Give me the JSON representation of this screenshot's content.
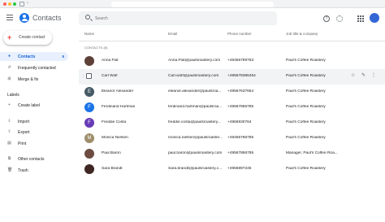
{
  "browser": {
    "url": ""
  },
  "app": {
    "title": "Contacts"
  },
  "search": {
    "placeholder": "Search"
  },
  "account": {
    "avatar_text": ""
  },
  "sidebar": {
    "create_label": "Create contact",
    "items": [
      {
        "label": "Contacts",
        "count": "8",
        "icon": "person-icon",
        "active": true
      },
      {
        "label": "Frequently contacted",
        "icon": "history-icon"
      },
      {
        "label": "Merge & fix",
        "icon": "merge-icon"
      }
    ],
    "labels_heading": "Labels",
    "create_label_item": "Create label",
    "tools": [
      {
        "label": "Import",
        "icon": "import-icon"
      },
      {
        "label": "Export",
        "icon": "export-icon"
      },
      {
        "label": "Print",
        "icon": "print-icon"
      }
    ],
    "other": [
      {
        "label": "Other contacts",
        "icon": "other-contacts-icon"
      },
      {
        "label": "Trash",
        "icon": "trash-icon"
      }
    ]
  },
  "table": {
    "headers": {
      "name": "Name",
      "email": "Email",
      "phone": "Phone number",
      "job": "Job title & company"
    },
    "section_label": "CONTACTS (8)",
    "rows": [
      {
        "initial": "",
        "name": "Anna Flat",
        "email": "Anna.Flat@paulsroastery.com",
        "phone": "+49456789763",
        "job": "Paul's Coffee Roastery",
        "color": "#5d4037"
      },
      {
        "initial": "",
        "name": "Carl Wolf",
        "email": "Carl.wolf@paulsroastery.com",
        "phone": "+495678386454",
        "job": "Paul's Coffee Roastery",
        "color": "#ffffff"
      },
      {
        "initial": "E",
        "name": "Eleanor Alexander",
        "email": "eleanor.alexander@paulsroa...",
        "phone": "+49567637654",
        "job": "Paul's Coffee Roastery",
        "color": "#455a64"
      },
      {
        "initial": "F",
        "name": "Ferdinand Hartman",
        "email": "ferdinand.hartman@paulsroa...",
        "phone": "+49567856785",
        "job": "Paul's Coffee Roastery",
        "color": "#1a73e8"
      },
      {
        "initial": "F",
        "name": "Freddie Costa",
        "email": "freddie.costa@paulsroastery...",
        "phone": "+4956930764",
        "job": "Paul's Coffee Roastery",
        "color": "#673ab7"
      },
      {
        "initial": "M",
        "name": "Monica Nielsen",
        "email": "monica.nielsen@paulsroaster...",
        "phone": "+49456786785",
        "job": "Paul's Coffee Roastery",
        "color": "#9e8e6b"
      },
      {
        "initial": "",
        "name": "Paul Baron",
        "email": "paul.baron@paulsroastery.com",
        "phone": "+49567856785",
        "job": "Manager, Paul's Coffee Roa...",
        "color": "#6d4c41"
      },
      {
        "initial": "",
        "name": "Sara Brandt",
        "email": "Sara.brandt@paulsroastery.c...",
        "phone": "+4956897245",
        "job": "Paul's Coffee Roastery",
        "color": "#3e2723"
      }
    ]
  },
  "colors": {
    "accent": "#1a73e8",
    "active_bg": "#e8f0fe",
    "create_plus": "#ea4335"
  }
}
